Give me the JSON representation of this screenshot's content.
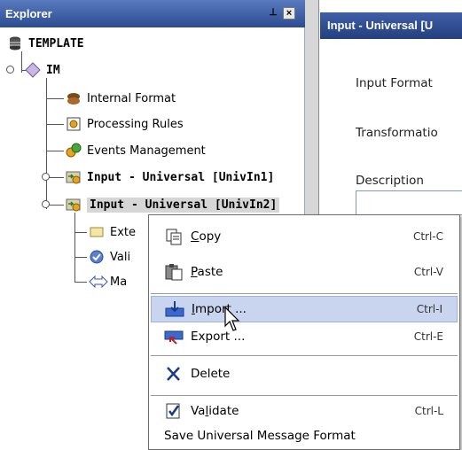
{
  "explorer": {
    "title": "Explorer",
    "pin_glyph": "Ⱶ",
    "close_glyph": "×"
  },
  "tree": {
    "root": "TEMPLATE",
    "im": "IM",
    "internal_format": "Internal Format",
    "processing_rules": "Processing Rules",
    "events_management": "Events Management",
    "input1": "Input - Universal [UnivIn1]",
    "input2": "Input - Universal [UnivIn2]",
    "child_ext": "Exte",
    "child_vali": "Vali",
    "child_map": "Ma"
  },
  "right_panel": {
    "tab_title": "Input - Universal [U",
    "input_format_label": "Input Format",
    "transformation_label": "Transformatio",
    "description_label": "Description"
  },
  "context_menu": {
    "items": [
      {
        "label": "Copy",
        "mnemonic": "C",
        "shortcut": "Ctrl-C",
        "icon": "copy-icon"
      },
      {
        "label": "Paste",
        "mnemonic": "P",
        "shortcut": "Ctrl-V",
        "icon": "paste-icon"
      },
      {
        "label": "Import ...",
        "mnemonic": "I",
        "shortcut": "Ctrl-I",
        "icon": "import-icon"
      },
      {
        "label": "Export ...",
        "mnemonic": "",
        "shortcut": "Ctrl-E",
        "icon": "export-icon"
      },
      {
        "label": "Delete",
        "mnemonic": "",
        "shortcut": "",
        "icon": "delete-icon"
      },
      {
        "label": "Validate",
        "mnemonic": "l",
        "shortcut": "Ctrl-L",
        "icon": "validate-icon"
      },
      {
        "label": "Save Universal Message Format",
        "mnemonic": "",
        "shortcut": "",
        "icon": ""
      }
    ]
  },
  "colors": {
    "header_blue": "#2c4c92",
    "menu_highlight": "#c9d4ee"
  }
}
